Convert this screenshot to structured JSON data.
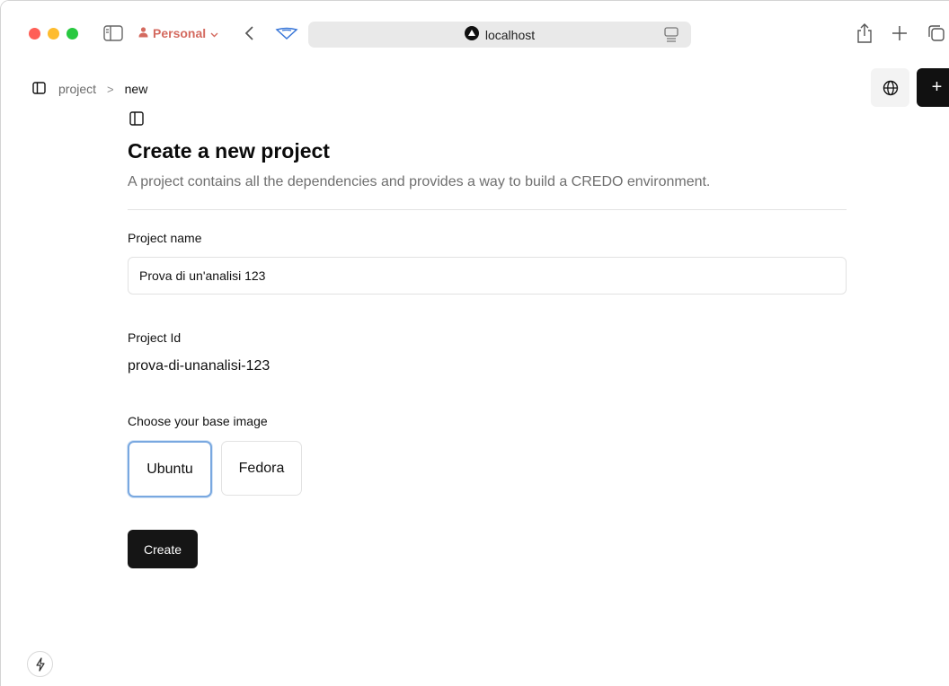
{
  "browser": {
    "profile_label": "Personal",
    "url_text": "localhost",
    "icons": {
      "sidebar": "sidebar-icon",
      "profile": "person-icon",
      "chevron": "chevron-down-icon",
      "back": "chevron-left-icon",
      "shield": "privacy-shield-icon",
      "site": "triangle-logo-icon",
      "reader": "reader-icon",
      "share": "share-icon",
      "new_tab": "plus-icon",
      "tabs": "tab-overview-icon"
    },
    "colors": {
      "profile": "#d46a5f",
      "close": "#ff5f57",
      "minimize": "#febc2e",
      "zoom": "#28c840"
    }
  },
  "header": {
    "breadcrumb": [
      {
        "label": "project"
      },
      {
        "label": "new"
      }
    ],
    "actions": {
      "globe": "globe-icon",
      "add_label": "+"
    }
  },
  "form": {
    "title": "Create a new project",
    "description": "A project contains all the dependencies and provides a way to build a CREDO environment.",
    "project_name_label": "Project name",
    "project_name_value": "Prova di un'analisi 123",
    "project_id_label": "Project Id",
    "project_id_value": "prova-di-unanalisi-123",
    "base_image_label": "Choose your base image",
    "base_images": [
      {
        "label": "Ubuntu",
        "selected": true
      },
      {
        "label": "Fedora",
        "selected": false
      }
    ],
    "submit_label": "Create",
    "colors": {
      "selected_border": "#79a8e0",
      "primary": "#151515"
    }
  }
}
